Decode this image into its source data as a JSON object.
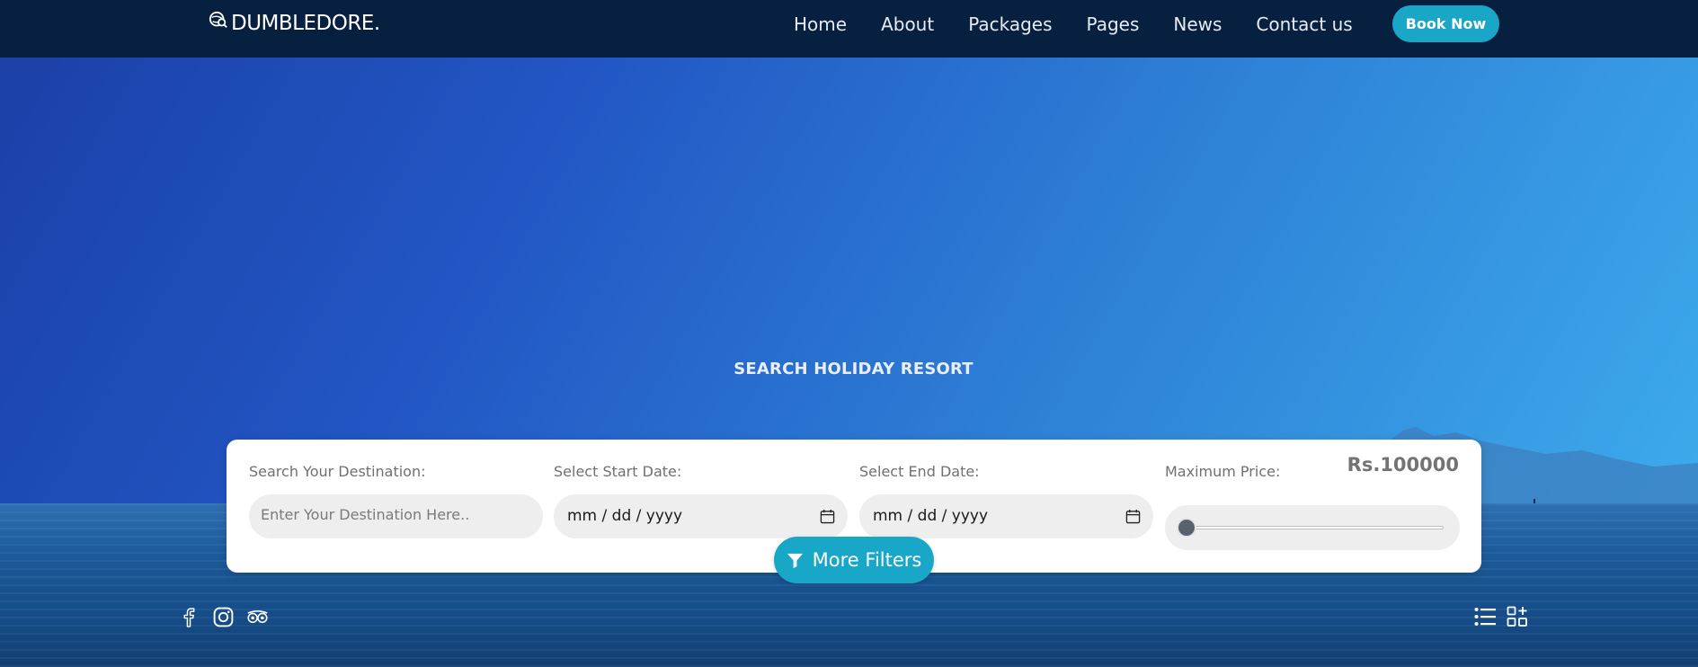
{
  "nav": {
    "logo_text": "DUMBLEDORE.",
    "links": [
      "Home",
      "About",
      "Packages",
      "Pages",
      "News",
      "Contact us"
    ],
    "book_button": "Book Now"
  },
  "hero": {
    "title": "SEARCH HOLIDAY RESORT"
  },
  "search": {
    "destination_label": "Search Your Destination:",
    "destination_placeholder": "Enter Your Destination Here..",
    "start_label": "Select Start Date:",
    "start_value": "mm / dd / yyyy",
    "end_label": "Select End Date:",
    "end_value": "mm / dd / yyyy",
    "price_label": "Maximum Price:",
    "price_value": "Rs.100000",
    "price_slider_fraction": 0,
    "more_filters": "More Filters"
  },
  "icons": {
    "social": [
      "facebook-icon",
      "instagram-icon",
      "tripadvisor-icon"
    ],
    "view": [
      "list-view-icon",
      "grid-view-icon"
    ]
  },
  "colors": {
    "navbar": "#08203f",
    "accent": "#1aa6c7",
    "card": "#ffffff",
    "pill": "#eeeeee"
  }
}
